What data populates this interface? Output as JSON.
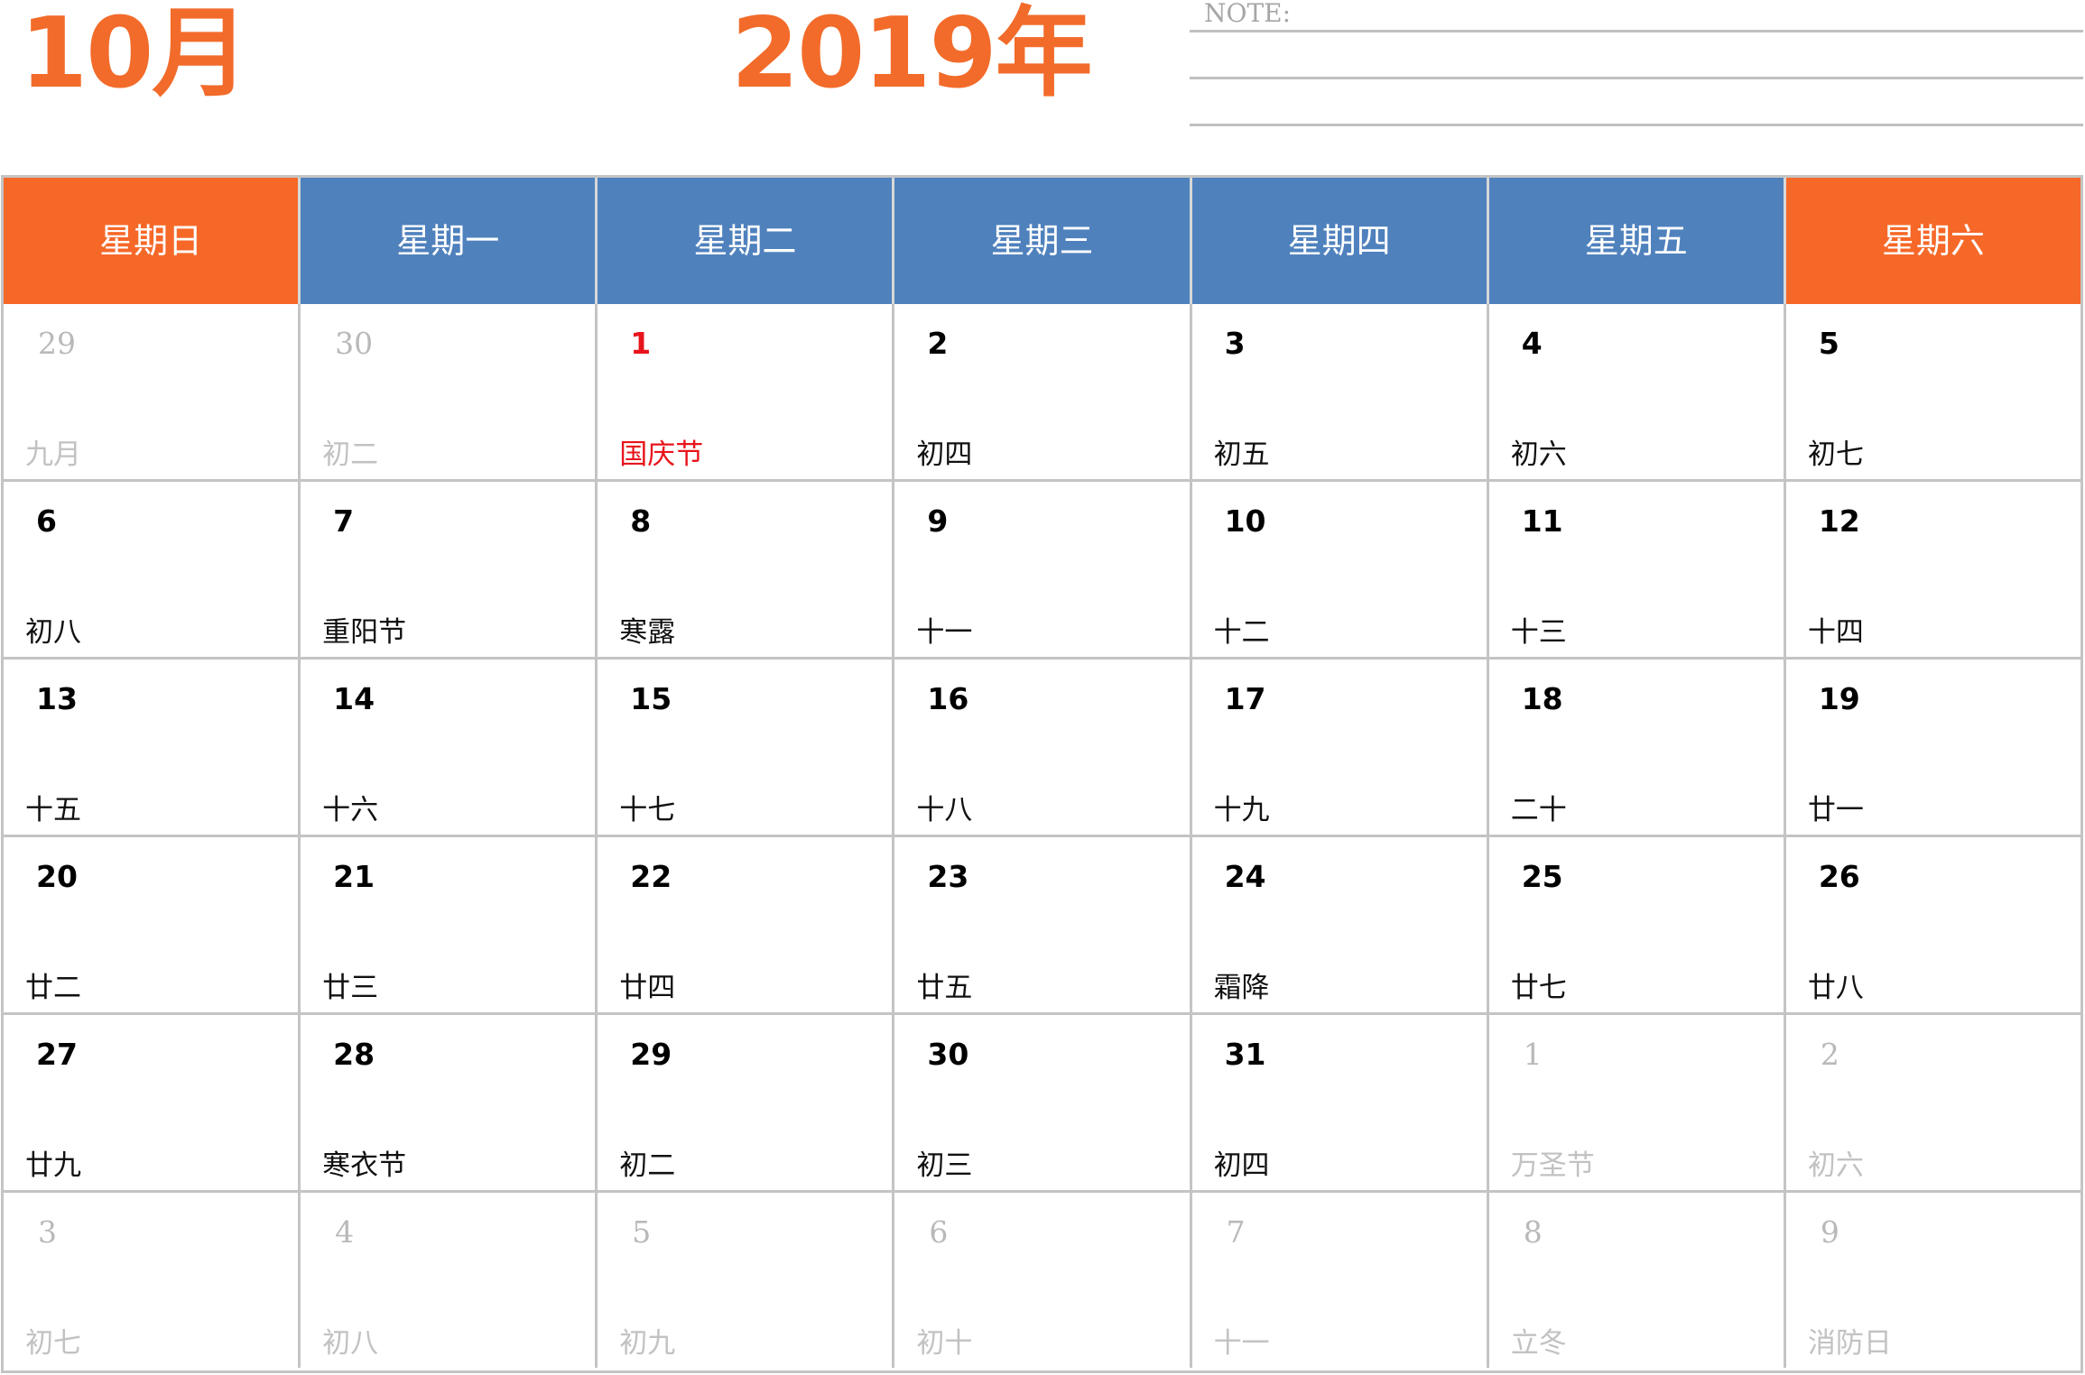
{
  "header": {
    "month": "10月",
    "year": "2019年",
    "note_label": "NOTE:"
  },
  "colors": {
    "accent_orange": "#f26b2a",
    "weekday_blue": "#4f81bd",
    "weekend_orange": "#f66828",
    "holiday_red": "#e8141b",
    "muted_gray": "#b9b9b9"
  },
  "weekdays": [
    {
      "label": "星期日",
      "weekend": true
    },
    {
      "label": "星期一",
      "weekend": false
    },
    {
      "label": "星期二",
      "weekend": false
    },
    {
      "label": "星期三",
      "weekend": false
    },
    {
      "label": "星期四",
      "weekend": false
    },
    {
      "label": "星期五",
      "weekend": false
    },
    {
      "label": "星期六",
      "weekend": true
    }
  ],
  "weeks": [
    [
      {
        "day": "29",
        "lunar": "九月",
        "current": false,
        "holiday": false
      },
      {
        "day": "30",
        "lunar": "初二",
        "current": false,
        "holiday": false
      },
      {
        "day": "1",
        "lunar": "国庆节",
        "current": true,
        "holiday": true
      },
      {
        "day": "2",
        "lunar": "初四",
        "current": true,
        "holiday": false
      },
      {
        "day": "3",
        "lunar": "初五",
        "current": true,
        "holiday": false
      },
      {
        "day": "4",
        "lunar": "初六",
        "current": true,
        "holiday": false
      },
      {
        "day": "5",
        "lunar": "初七",
        "current": true,
        "holiday": false
      }
    ],
    [
      {
        "day": "6",
        "lunar": "初八",
        "current": true,
        "holiday": false
      },
      {
        "day": "7",
        "lunar": "重阳节",
        "current": true,
        "holiday": false
      },
      {
        "day": "8",
        "lunar": "寒露",
        "current": true,
        "holiday": false
      },
      {
        "day": "9",
        "lunar": "十一",
        "current": true,
        "holiday": false
      },
      {
        "day": "10",
        "lunar": "十二",
        "current": true,
        "holiday": false
      },
      {
        "day": "11",
        "lunar": "十三",
        "current": true,
        "holiday": false
      },
      {
        "day": "12",
        "lunar": "十四",
        "current": true,
        "holiday": false
      }
    ],
    [
      {
        "day": "13",
        "lunar": "十五",
        "current": true,
        "holiday": false
      },
      {
        "day": "14",
        "lunar": "十六",
        "current": true,
        "holiday": false
      },
      {
        "day": "15",
        "lunar": "十七",
        "current": true,
        "holiday": false
      },
      {
        "day": "16",
        "lunar": "十八",
        "current": true,
        "holiday": false
      },
      {
        "day": "17",
        "lunar": "十九",
        "current": true,
        "holiday": false
      },
      {
        "day": "18",
        "lunar": "二十",
        "current": true,
        "holiday": false
      },
      {
        "day": "19",
        "lunar": "廿一",
        "current": true,
        "holiday": false
      }
    ],
    [
      {
        "day": "20",
        "lunar": "廿二",
        "current": true,
        "holiday": false
      },
      {
        "day": "21",
        "lunar": "廿三",
        "current": true,
        "holiday": false
      },
      {
        "day": "22",
        "lunar": "廿四",
        "current": true,
        "holiday": false
      },
      {
        "day": "23",
        "lunar": "廿五",
        "current": true,
        "holiday": false
      },
      {
        "day": "24",
        "lunar": "霜降",
        "current": true,
        "holiday": false
      },
      {
        "day": "25",
        "lunar": "廿七",
        "current": true,
        "holiday": false
      },
      {
        "day": "26",
        "lunar": "廿八",
        "current": true,
        "holiday": false
      }
    ],
    [
      {
        "day": "27",
        "lunar": "廿九",
        "current": true,
        "holiday": false
      },
      {
        "day": "28",
        "lunar": "寒衣节",
        "current": true,
        "holiday": false
      },
      {
        "day": "29",
        "lunar": "初二",
        "current": true,
        "holiday": false
      },
      {
        "day": "30",
        "lunar": "初三",
        "current": true,
        "holiday": false
      },
      {
        "day": "31",
        "lunar": "初四",
        "current": true,
        "holiday": false
      },
      {
        "day": "1",
        "lunar": "万圣节",
        "current": false,
        "holiday": false
      },
      {
        "day": "2",
        "lunar": "初六",
        "current": false,
        "holiday": false
      }
    ],
    [
      {
        "day": "3",
        "lunar": "初七",
        "current": false,
        "holiday": false
      },
      {
        "day": "4",
        "lunar": "初八",
        "current": false,
        "holiday": false
      },
      {
        "day": "5",
        "lunar": "初九",
        "current": false,
        "holiday": false
      },
      {
        "day": "6",
        "lunar": "初十",
        "current": false,
        "holiday": false
      },
      {
        "day": "7",
        "lunar": "十一",
        "current": false,
        "holiday": false
      },
      {
        "day": "8",
        "lunar": "立冬",
        "current": false,
        "holiday": false
      },
      {
        "day": "9",
        "lunar": "消防日",
        "current": false,
        "holiday": false
      }
    ]
  ]
}
